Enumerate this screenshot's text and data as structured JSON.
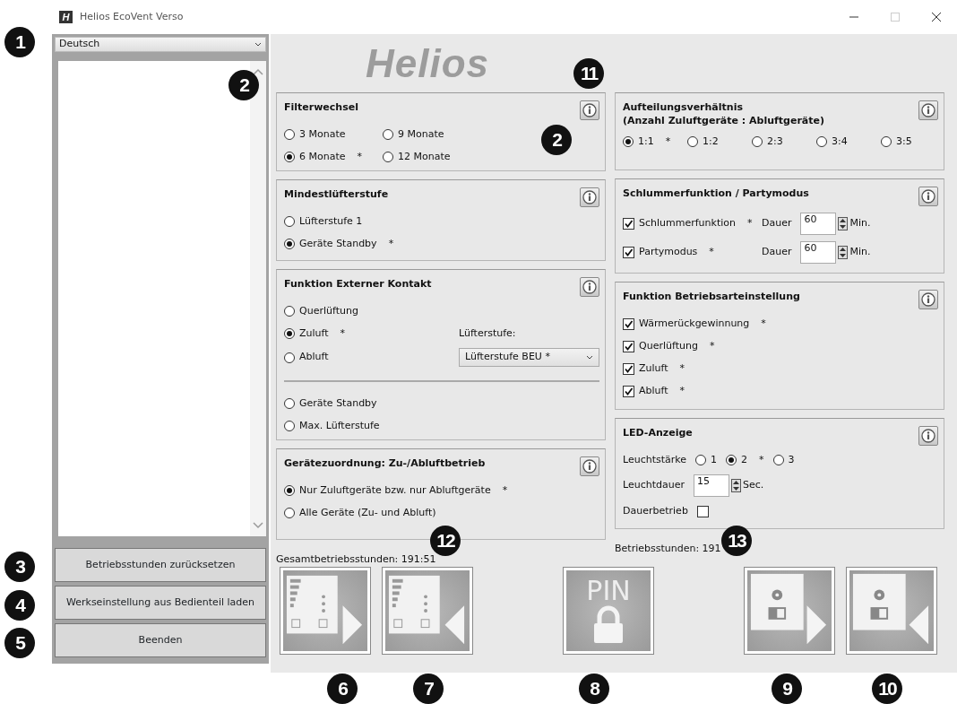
{
  "window": {
    "icon_text": "H",
    "title": "Helios EcoVent Verso"
  },
  "sidebar": {
    "language": "Deutsch",
    "buttons": [
      "Betriebsstunden zurücksetzen",
      "Werkseinstellung aus Bedienteil laden",
      "Beenden"
    ]
  },
  "logo": "Helios",
  "left_column": [
    {
      "title": "Filterwechsel",
      "info": true,
      "rows": [
        [
          {
            "kind": "radio",
            "label": "3 Monate",
            "selected": false
          },
          {
            "kind": "radio",
            "label": "9 Monate",
            "selected": false
          }
        ],
        [
          {
            "kind": "radio",
            "label": "6 Monate",
            "note": "*",
            "selected": true
          },
          {
            "kind": "radio",
            "label": "12 Monate",
            "selected": false
          }
        ]
      ]
    },
    {
      "title": "Mindestlüfterstufe",
      "info": true,
      "rows": [
        [
          {
            "kind": "radio",
            "label": "Lüfterstufe 1",
            "selected": false
          }
        ],
        [
          {
            "kind": "radio",
            "label": "Geräte Standby",
            "note": "*",
            "selected": true
          }
        ]
      ]
    },
    {
      "title": "Funktion Externer Kontakt",
      "info": true,
      "rows": [
        [
          {
            "kind": "radio",
            "label": "Querlüftung",
            "selected": false
          }
        ],
        [
          {
            "kind": "radio",
            "label": "Zuluft",
            "note": "*",
            "selected": true
          },
          {
            "kind": "label",
            "label": "Lüfterstufe:"
          }
        ],
        [
          {
            "kind": "radio",
            "label": "Abluft",
            "selected": false
          },
          {
            "kind": "select",
            "value": "Lüfterstufe BEU *"
          }
        ],
        [
          {
            "kind": "rule"
          }
        ],
        [
          {
            "kind": "radio",
            "label": "Geräte Standby",
            "selected": false
          }
        ],
        [
          {
            "kind": "radio",
            "label": "Max. Lüfterstufe",
            "selected": false
          }
        ]
      ]
    },
    {
      "title": "Gerätezuordnung: Zu-/Abluftbetrieb",
      "info": true,
      "rows": [
        [
          {
            "kind": "radio",
            "label": "Nur Zuluftgeräte bzw. nur Abluftgeräte",
            "note": "*",
            "selected": true
          }
        ],
        [
          {
            "kind": "radio",
            "label": "Alle Geräte (Zu- und Abluft)",
            "selected": false
          }
        ]
      ]
    }
  ],
  "left_status": "Gesamtbetriebsstunden: 191:51",
  "right_column": [
    {
      "title": "Aufteilungsverhältnis\n(Anzahl Zuluftgeräte : Abluftgeräte)",
      "info": true,
      "rows": [
        [
          {
            "kind": "radio",
            "label": "1:1",
            "note": "*",
            "selected": true
          },
          {
            "kind": "radio",
            "label": "1:2",
            "selected": false
          },
          {
            "kind": "radio",
            "label": "2:3",
            "selected": false
          },
          {
            "kind": "radio",
            "label": "3:4",
            "selected": false
          },
          {
            "kind": "radio",
            "label": "3:5",
            "selected": false
          }
        ]
      ]
    },
    {
      "title": "Schlummerfunktion / Partymodus",
      "info": true,
      "rows": [
        [
          {
            "kind": "checkbox",
            "label": "Schlummerfunktion",
            "note": "*",
            "checked": true
          },
          {
            "kind": "label",
            "label": "Dauer"
          },
          {
            "kind": "spin",
            "value": "60"
          },
          {
            "kind": "label",
            "label": "Min."
          }
        ],
        [
          {
            "kind": "checkbox",
            "label": "Partymodus",
            "note": "*",
            "checked": true
          },
          {
            "kind": "label",
            "label": "Dauer"
          },
          {
            "kind": "spin",
            "value": "60"
          },
          {
            "kind": "label",
            "label": "Min."
          }
        ]
      ]
    },
    {
      "title": "Funktion Betriebsarteinstellung",
      "info": true,
      "rows": [
        [
          {
            "kind": "checkbox",
            "label": "Wärmerückgewinnung",
            "note": "*",
            "checked": true
          }
        ],
        [
          {
            "kind": "checkbox",
            "label": "Querlüftung",
            "note": "*",
            "checked": true
          }
        ],
        [
          {
            "kind": "checkbox",
            "label": "Zuluft",
            "note": "*",
            "checked": true
          }
        ],
        [
          {
            "kind": "checkbox",
            "label": "Abluft",
            "note": "*",
            "checked": true
          }
        ]
      ]
    },
    {
      "title": "LED-Anzeige",
      "info": true,
      "rows": [
        [
          {
            "kind": "label",
            "label": "Leuchtstärke"
          },
          {
            "kind": "radio",
            "label": "1",
            "selected": false
          },
          {
            "kind": "radio",
            "label": "2",
            "note": "*",
            "selected": true
          },
          {
            "kind": "radio",
            "label": "3",
            "selected": false
          }
        ],
        [
          {
            "kind": "label",
            "label": "Leuchtdauer"
          },
          {
            "kind": "spin",
            "value": "15"
          },
          {
            "kind": "label",
            "label": "Sec."
          }
        ],
        [
          {
            "kind": "label",
            "label": "Dauerbetrieb"
          },
          {
            "kind": "checkbox",
            "checked": false
          }
        ]
      ]
    }
  ],
  "right_status": "Betriebsstunden: 191",
  "toolbar": [
    {
      "kind": "levels-out"
    },
    {
      "kind": "levels-in"
    },
    {
      "kind": "pin",
      "label": "PIN"
    },
    {
      "kind": "disk-out"
    },
    {
      "kind": "disk-in"
    }
  ],
  "callouts": [
    "1",
    "2",
    "11",
    "2",
    "12",
    "13",
    "3",
    "4",
    "5",
    "6",
    "7",
    "8",
    "9",
    "10"
  ]
}
